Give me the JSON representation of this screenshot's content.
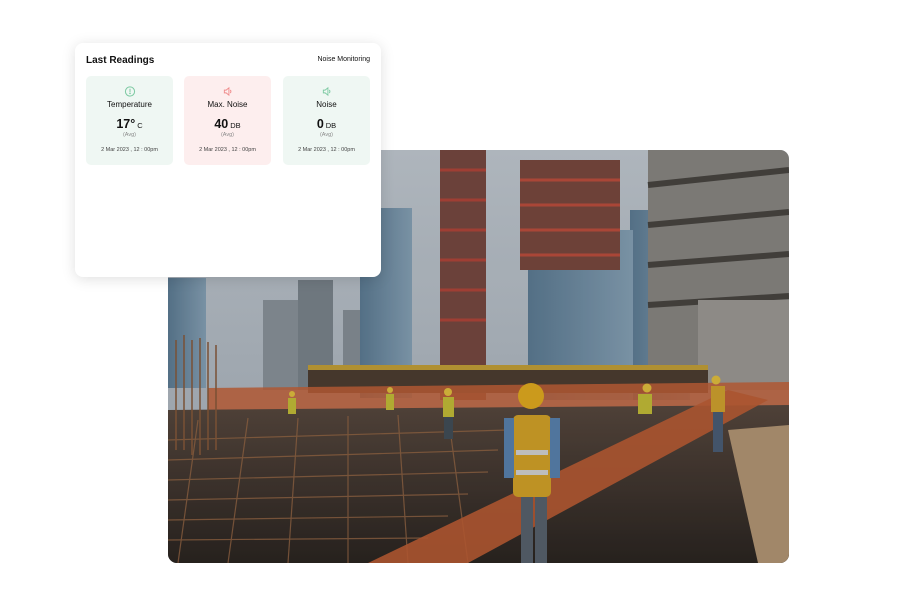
{
  "card": {
    "title": "Last Readings",
    "link": "Noise Monitoring"
  },
  "readings": [
    {
      "label": "Temperature",
      "value": "17°",
      "unit": "C",
      "avg": "(Avg)",
      "time": "2 Mar 2023 , 12 : 00pm",
      "icon": "thermometer-icon",
      "color": "#7cc9a2"
    },
    {
      "label": "Max. Noise",
      "value": "40",
      "unit": "DB",
      "avg": "(Avg)",
      "time": "2 Mar 2023 , 12 : 00pm",
      "icon": "speaker-icon",
      "color": "#ef8a8a"
    },
    {
      "label": "Noise",
      "value": "0",
      "unit": "DB",
      "avg": "(Avg)",
      "time": "2 Mar 2023 , 12 : 00pm",
      "icon": "speaker-icon",
      "color": "#7cc9a2"
    }
  ],
  "photo": {
    "subject": "construction-site-image"
  }
}
